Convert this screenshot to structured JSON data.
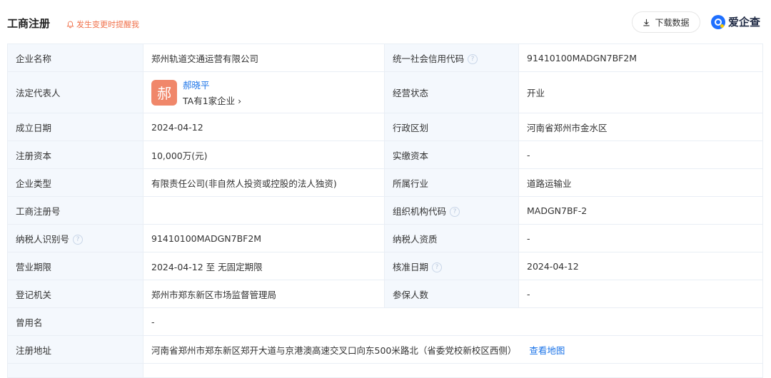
{
  "header": {
    "title": "工商注册",
    "remind_label": "发生变更时提醒我",
    "download_label": "下载数据",
    "brand_name": "爱企查"
  },
  "rows": {
    "r1": {
      "l1": "企业名称",
      "v1": "郑州轨道交通运营有限公司",
      "l2": "统一社会信用代码",
      "v2": "91410100MADGN7BF2M"
    },
    "r2": {
      "l1": "法定代表人",
      "avatar_char": "郝",
      "person_name": "郝晓平",
      "person_sub": "TA有1家企业 ›",
      "l2": "经营状态",
      "v2": "开业"
    },
    "r3": {
      "l1": "成立日期",
      "v1": "2024-04-12",
      "l2": "行政区划",
      "v2": "河南省郑州市金水区"
    },
    "r4": {
      "l1": "注册资本",
      "v1": "10,000万(元)",
      "l2": "实缴资本",
      "v2": "-"
    },
    "r5": {
      "l1": "企业类型",
      "v1": "有限责任公司(非自然人投资或控股的法人独资)",
      "l2": "所属行业",
      "v2": "道路运输业"
    },
    "r6": {
      "l1": "工商注册号",
      "v1": "",
      "l2": "组织机构代码",
      "v2": "MADGN7BF-2"
    },
    "r7": {
      "l1": "纳税人识别号",
      "v1": "91410100MADGN7BF2M",
      "l2": "纳税人资质",
      "v2": "-"
    },
    "r8": {
      "l1": "营业期限",
      "v1": "2024-04-12 至 无固定期限",
      "l2": "核准日期",
      "v2": "2024-04-12"
    },
    "r9": {
      "l1": "登记机关",
      "v1": "郑州市郑东新区市场监督管理局",
      "l2": "参保人数",
      "v2": "-"
    },
    "r10": {
      "l1": "曾用名",
      "v1": "-"
    },
    "r11": {
      "l1": "注册地址",
      "v1": "河南省郑州市郑东新区郑开大道与京港澳高速交叉口向东500米路北（省委党校新校区西侧）",
      "link": "查看地图"
    }
  },
  "help_glyph": "?",
  "colors": {
    "label_bg": "#f4f8fd",
    "link": "#1a73e8",
    "accent": "#f0704a",
    "avatar": "#f0876a"
  }
}
